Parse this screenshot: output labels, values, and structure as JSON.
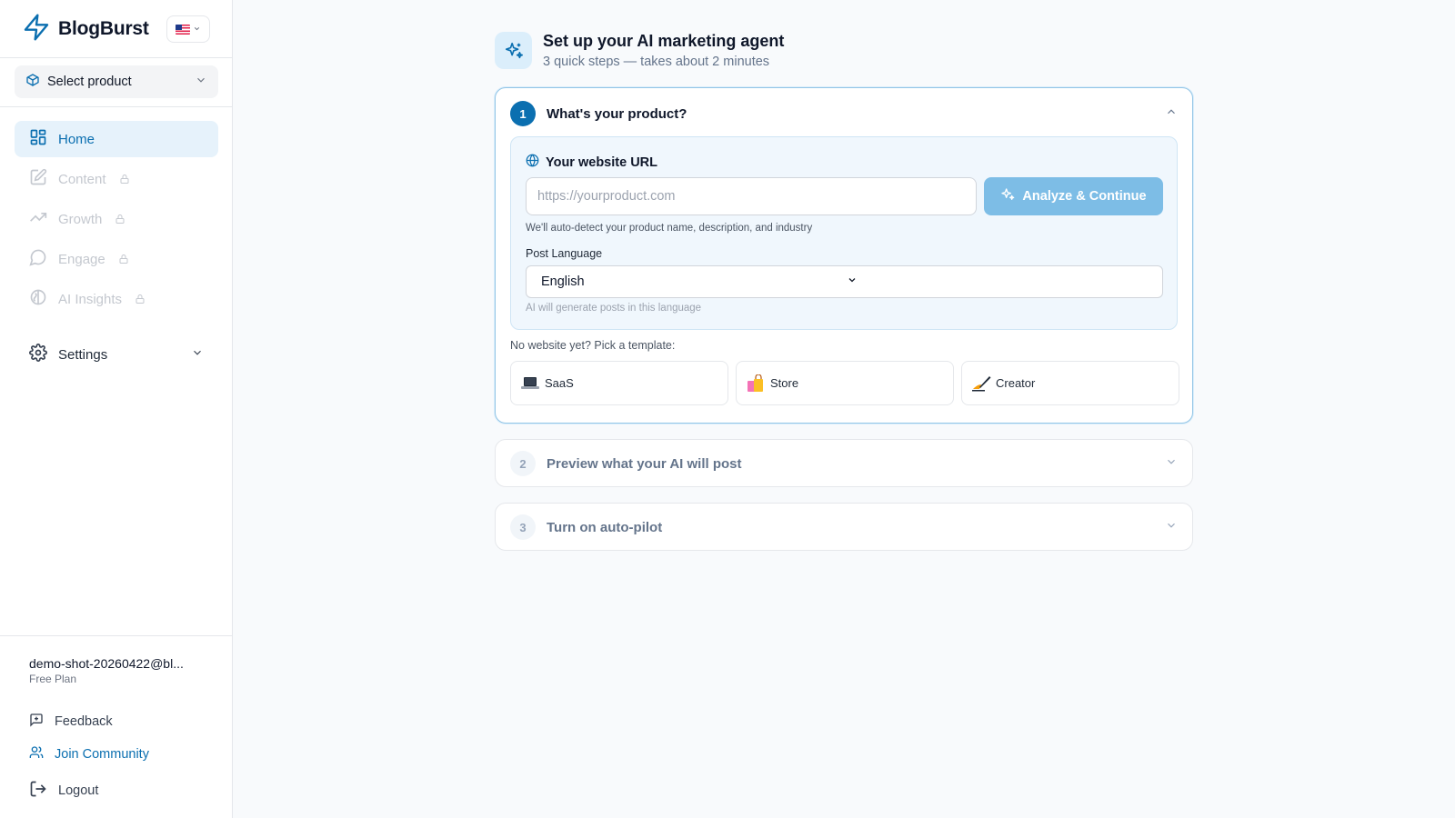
{
  "app": {
    "name": "BlogBurst",
    "language_flag": "us-flag"
  },
  "sidebar": {
    "product_select": {
      "label": "Select product",
      "icon": "package-icon"
    },
    "nav": [
      {
        "label": "Home",
        "icon": "grid-icon",
        "active": true,
        "locked": false
      },
      {
        "label": "Content",
        "icon": "edit-icon",
        "active": false,
        "locked": true
      },
      {
        "label": "Growth",
        "icon": "trending-up-icon",
        "active": false,
        "locked": true
      },
      {
        "label": "Engage",
        "icon": "message-circle-icon",
        "active": false,
        "locked": true
      },
      {
        "label": "AI Insights",
        "icon": "brain-icon",
        "active": false,
        "locked": true
      }
    ],
    "settings_label": "Settings",
    "account": {
      "email": "demo-shot-20260422@bl...",
      "plan": "Free Plan"
    },
    "footer": {
      "feedback": "Feedback",
      "community": "Join Community",
      "logout": "Logout"
    }
  },
  "main": {
    "title": "Set up your AI marketing agent",
    "subtitle": "3 quick steps — takes about 2 minutes",
    "steps": [
      {
        "number": "1",
        "title": "What's your product?",
        "expanded": true
      },
      {
        "number": "2",
        "title": "Preview what your AI will post",
        "expanded": false
      },
      {
        "number": "3",
        "title": "Turn on auto-pilot",
        "expanded": false
      }
    ],
    "step1": {
      "url_label": "Your website URL",
      "url_placeholder": "https://yourproduct.com",
      "url_value": "",
      "analyze_label": "Analyze & Continue",
      "url_hint": "We'll auto-detect your product name, description, and industry",
      "language_label": "Post Language",
      "language_value": "English",
      "language_hint": "AI will generate posts in this language",
      "template_prompt": "No website yet? Pick a template:",
      "templates": [
        {
          "label": "SaaS",
          "emoji": "💻"
        },
        {
          "label": "Store",
          "emoji": "🛍️"
        },
        {
          "label": "Creator",
          "emoji": "✍️"
        }
      ]
    }
  },
  "colors": {
    "accent": "#0b6fb0",
    "accent_light": "#e6f2fb",
    "button_disabled": "#7dbde6",
    "background": "#f8fafc"
  }
}
